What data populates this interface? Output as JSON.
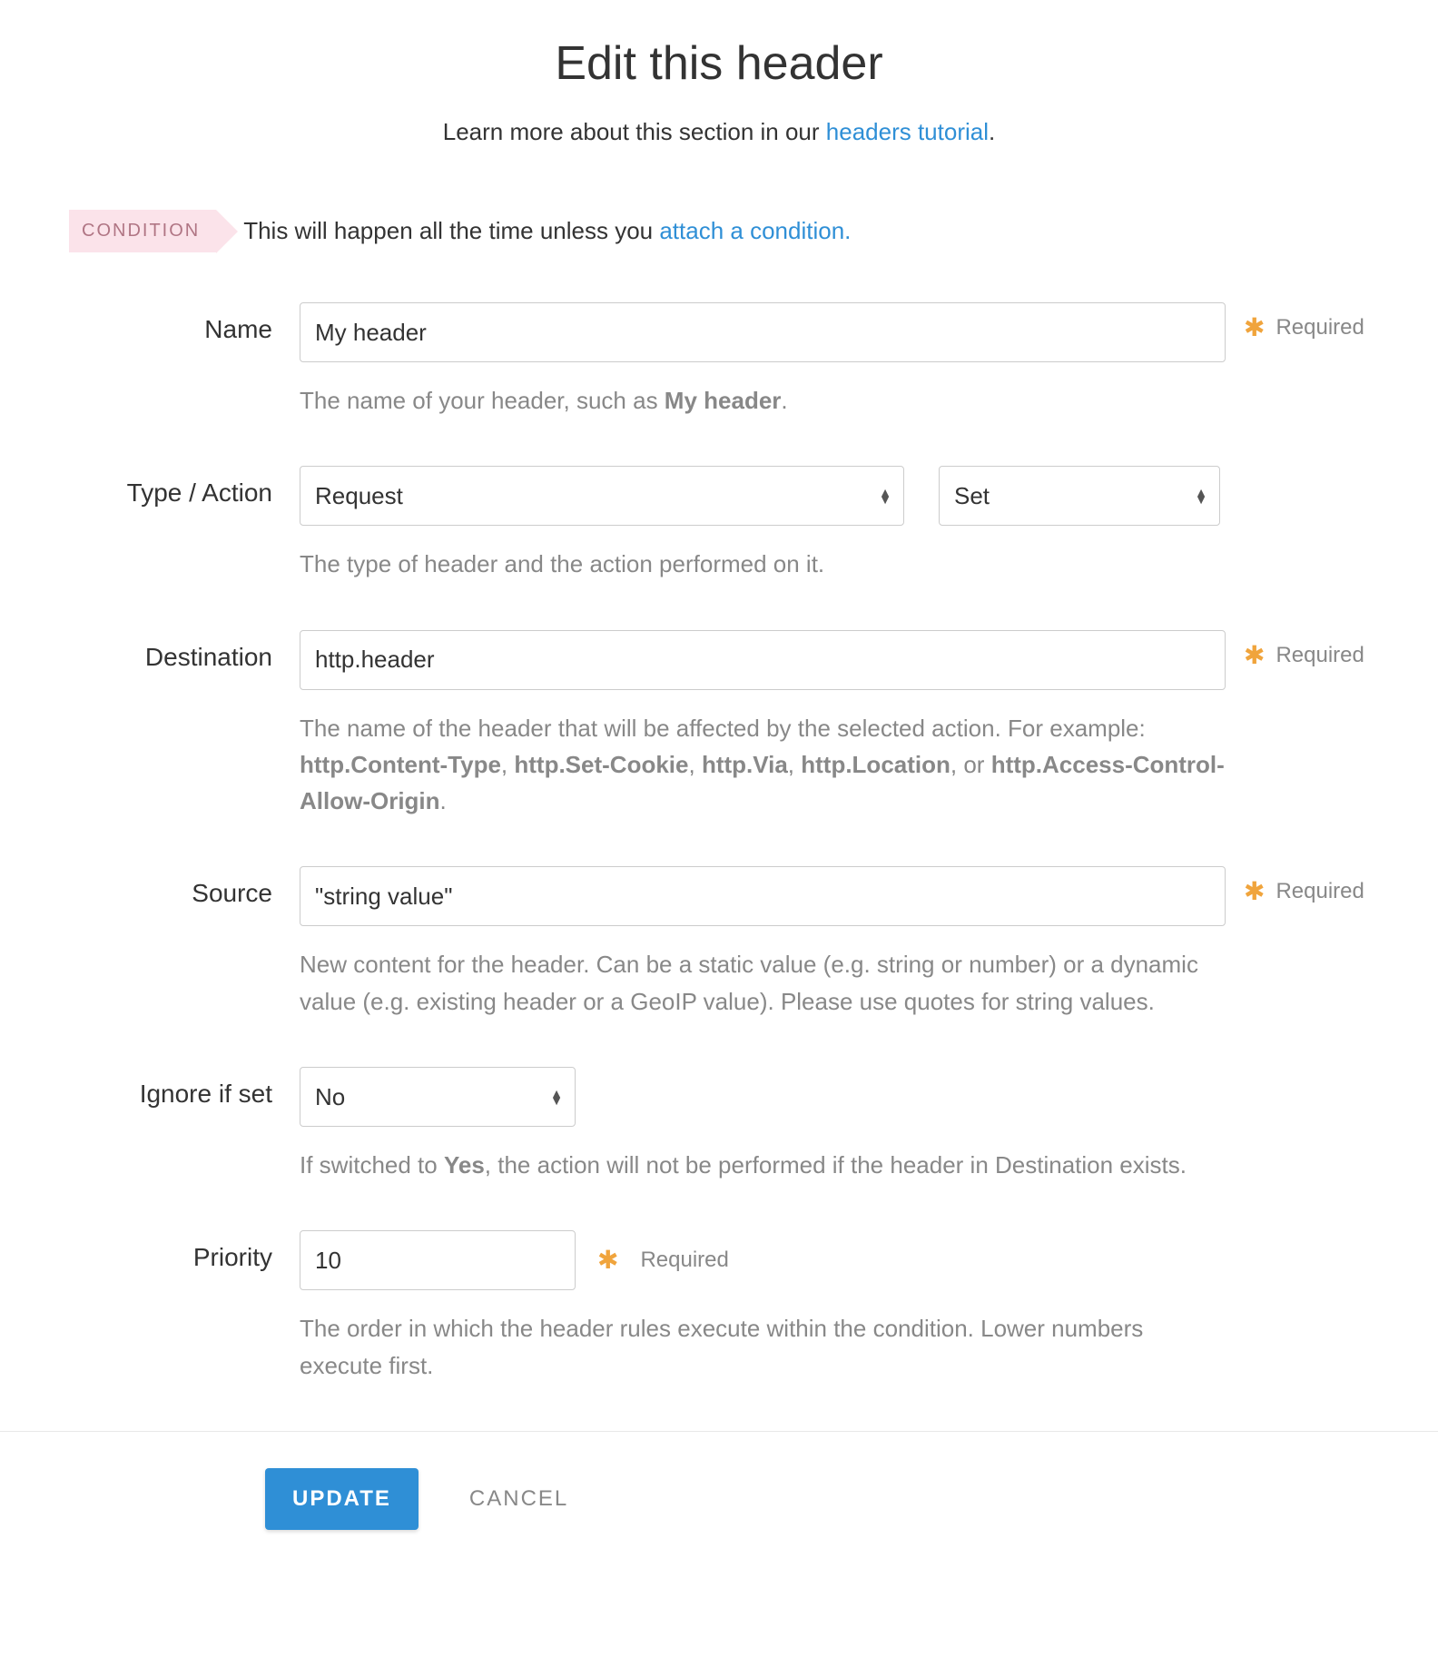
{
  "page": {
    "title": "Edit this header",
    "subtitle_prefix": "Learn more about this section in our ",
    "subtitle_link": "headers tutorial",
    "subtitle_suffix": "."
  },
  "condition": {
    "tag": "CONDITION",
    "text_prefix": "This will happen all the time unless you ",
    "link": "attach a condition."
  },
  "labels": {
    "name": "Name",
    "type_action": "Type / Action",
    "destination": "Destination",
    "source": "Source",
    "ignore_if_set": "Ignore if set",
    "priority": "Priority"
  },
  "required_text": "Required",
  "fields": {
    "name": {
      "value": "My header",
      "helper_prefix": "The name of your header, such as ",
      "helper_strong": "My header",
      "helper_suffix": "."
    },
    "type": {
      "selected": "Request"
    },
    "action": {
      "selected": "Set"
    },
    "type_action_helper": "The type of header and the action performed on it.",
    "destination": {
      "value": "http.header",
      "helper_prefix": "The name of the header that will be affected by the selected action. For example: ",
      "ex1": "http.Content-Type",
      "sep1": ", ",
      "ex2": "http.Set-Cookie",
      "sep2": ", ",
      "ex3": "http.Via",
      "sep3": ", ",
      "ex4": "http.Location",
      "sep4": ", or ",
      "ex5": "http.Access-Control-Allow-Origin",
      "helper_suffix": "."
    },
    "source": {
      "value": "\"string value\"",
      "helper": "New content for the header. Can be a static value (e.g. string or number) or a dynamic value (e.g. existing header or a GeoIP value). Please use quotes for string values."
    },
    "ignore_if_set": {
      "selected": "No",
      "helper_prefix": "If switched to ",
      "helper_strong": "Yes",
      "helper_suffix": ", the action will not be performed if the header in Destination exists."
    },
    "priority": {
      "value": "10",
      "helper": "The order in which the header rules execute within the condition. Lower numbers execute first."
    }
  },
  "footer": {
    "update": "UPDATE",
    "cancel": "CANCEL"
  }
}
